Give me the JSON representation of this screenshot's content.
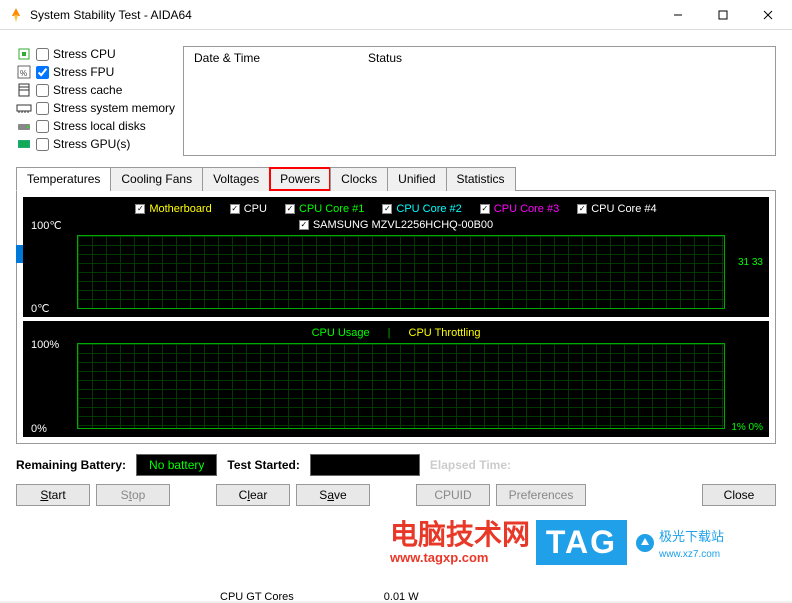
{
  "window": {
    "title": "System Stability Test - AIDA64"
  },
  "stress": {
    "cpu": "Stress CPU",
    "fpu": "Stress FPU",
    "cache": "Stress cache",
    "memory": "Stress system memory",
    "disks": "Stress local disks",
    "gpu": "Stress GPU(s)"
  },
  "log": {
    "date_time": "Date & Time",
    "status": "Status"
  },
  "tabs": {
    "temperatures": "Temperatures",
    "cooling": "Cooling Fans",
    "voltages": "Voltages",
    "powers": "Powers",
    "clocks": "Clocks",
    "unified": "Unified",
    "statistics": "Statistics"
  },
  "legend1": {
    "motherboard": "Motherboard",
    "cpu": "CPU",
    "core1": "CPU Core #1",
    "core2": "CPU Core #2",
    "core3": "CPU Core #3",
    "core4": "CPU Core #4",
    "ssd": "SAMSUNG MZVL2256HCHQ-00B00",
    "ytop": "100℃",
    "ybot": "0℃",
    "reading": "31 33"
  },
  "legend2": {
    "usage": "CPU Usage",
    "throttling": "CPU Throttling",
    "sep": "|",
    "ytop": "100%",
    "ybot": "0%",
    "reading": "1% 0%"
  },
  "status_row": {
    "battery_label": "Remaining Battery:",
    "battery_value": "No battery",
    "started_label": "Test Started:",
    "elapsed_label": "Elapsed Time:"
  },
  "buttons": {
    "start": "Start",
    "stop": "Stop",
    "clear": "Clear",
    "save": "Save",
    "cpuid": "CPUID",
    "prefs": "Preferences",
    "close": "Close"
  },
  "colors": {
    "motherboard": "#ffff00",
    "cpu": "#ffffff",
    "core1": "#00ff00",
    "core2": "#00ffff",
    "core3": "#ff00ff",
    "core4": "#ffffff",
    "usage": "#00ff00",
    "throttling": "#ffff00"
  },
  "watermark": {
    "cn1": "电脑技术网",
    "cn1_sub": "www.tagxp.com",
    "tag": "TAG",
    "cn2": "极光下载站",
    "cn2_sub": "www.xz7.com"
  },
  "footer_extra": {
    "cpu_gt": "CPU GT Cores",
    "cpu_gt_val": "0.01 W"
  }
}
